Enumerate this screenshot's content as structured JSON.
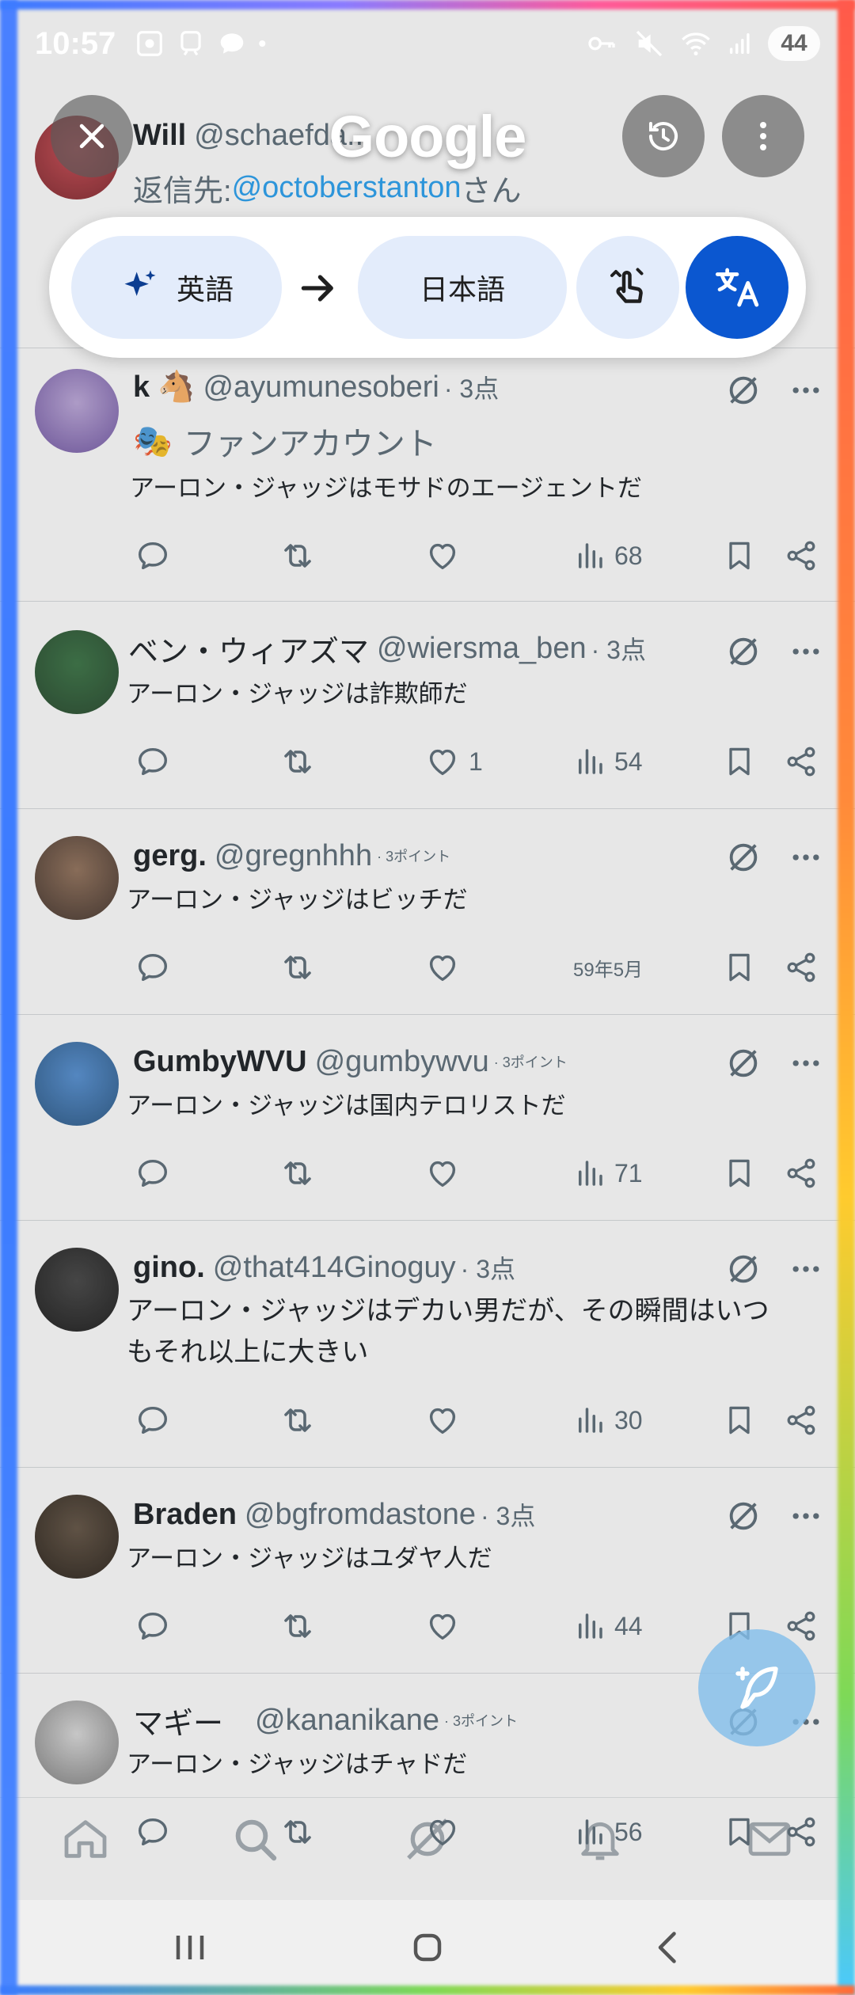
{
  "status_bar": {
    "time": "10:57",
    "battery": "44"
  },
  "translate_overlay": {
    "logo": "Google",
    "source_lang": "英語",
    "target_lang": "日本語"
  },
  "tweets": [
    {
      "name": "Will",
      "handle": "@schaefda...",
      "reply_prefix": "返信先: ",
      "reply_to": "@octoberstanton",
      "reply_suffix": "さん"
    },
    {
      "name": "k",
      "handle": "@ayumunesoberi",
      "time": "· 3点",
      "subtitle": "ファンアカウント",
      "text": "アーロン・ジャッジはモサドのエージェントだ",
      "views": "68"
    },
    {
      "name": "ベン・ウィアズマ",
      "handle": "@wiersma_ben",
      "time": "· 3点",
      "text": "アーロン・ジャッジは詐欺師だ",
      "likes": "1",
      "views": "54"
    },
    {
      "name": "gerg.",
      "handle": "@gregnhhh",
      "time": "· 3ポイント",
      "text": "アーロン・ジャッジはビッチだ",
      "views": "59年5月"
    },
    {
      "name": "GumbyWVU",
      "handle": "@gumbywvu",
      "time": "· 3ポイント",
      "text": "アーロン・ジャッジは国内テロリストだ",
      "views": "71"
    },
    {
      "name": "gino.",
      "handle": "@that414Ginoguy",
      "time": "· 3点",
      "text": "アーロン・ジャッジはデカい男だが、その瞬間はいつもそれ以上に大きい",
      "views": "30"
    },
    {
      "name": "Braden",
      "handle": "@bgfromdastone",
      "time": "· 3点",
      "text": "アーロン・ジャッジはユダヤ人だ",
      "views": "44"
    },
    {
      "name": "マギー",
      "handle": "@kananikane",
      "time": "· 3ポイント",
      "text": "アーロン・ジャッジはチャドだ",
      "views": "56"
    }
  ],
  "icons": {
    "reply": "reply-icon",
    "retweet": "retweet-icon",
    "like": "heart-icon",
    "views": "views-icon",
    "bookmark": "bookmark-icon",
    "share": "share-icon",
    "grok": "grok-icon",
    "more": "more-icon"
  }
}
